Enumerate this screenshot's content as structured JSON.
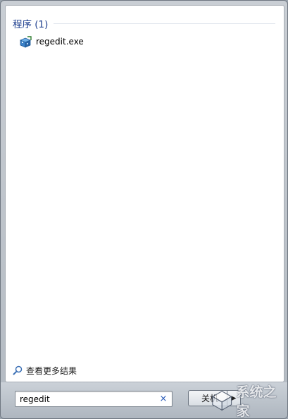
{
  "results": {
    "group_title": "程序 (1)",
    "items": [
      {
        "label": "regedit.exe",
        "icon": "registry-editor-icon"
      }
    ],
    "more_results_label": "查看更多结果"
  },
  "search": {
    "value": "regedit",
    "clear_symbol": "×"
  },
  "shutdown": {
    "label": "关机",
    "arrow": "▶"
  },
  "watermark": {
    "text": "系统之家"
  },
  "colors": {
    "group_title": "#1e3f8f",
    "clear_icon": "#2b5cb8"
  }
}
